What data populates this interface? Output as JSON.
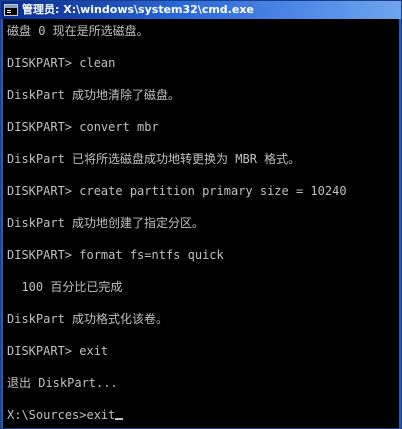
{
  "window": {
    "title": "管理员: X:\\windows\\system32\\cmd.exe"
  },
  "console": {
    "lines": [
      "磁盘 0 现在是所选磁盘。",
      "",
      "DISKPART> clean",
      "",
      "DiskPart 成功地清除了磁盘。",
      "",
      "DISKPART> convert mbr",
      "",
      "DiskPart 已将所选磁盘成功地转更换为 MBR 格式。",
      "",
      "DISKPART> create partition primary size = 10240",
      "",
      "DiskPart 成功地创建了指定分区。",
      "",
      "DISKPART> format fs=ntfs quick",
      "",
      "  100 百分比已完成",
      "",
      "DiskPart 成功格式化该卷。",
      "",
      "DISKPART> exit",
      "",
      "退出 DiskPart...",
      "",
      "X:\\Sources>exit"
    ]
  },
  "colors": {
    "console_bg": "#000000",
    "console_text": "#c0c0c0",
    "titlebar_start": "#0a2a8c",
    "titlebar_end": "#6ea4ef"
  }
}
